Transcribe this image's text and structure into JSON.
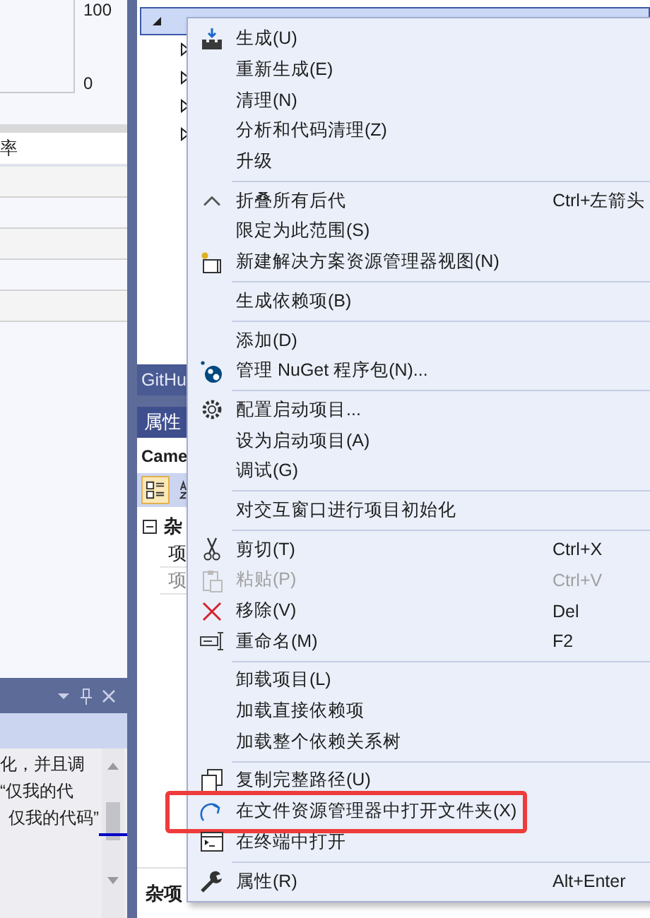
{
  "left_panel": {
    "chart": {
      "axis_labels": [
        "100",
        "0"
      ]
    },
    "grid": {
      "column_header": "率"
    }
  },
  "output_panel": {
    "lines": [
      "化，并且调",
      "“仅我的代",
      "仅我的代码”"
    ]
  },
  "solution_explorer": {
    "selected_row": {
      "expanded": true,
      "selected": true
    },
    "child_rows": [
      {
        "expanded": false
      },
      {
        "expanded": false
      },
      {
        "expanded": false
      },
      {
        "expanded": false
      }
    ]
  },
  "tool_tabs": [
    {
      "label": "GitHu"
    }
  ],
  "properties": {
    "title": "属性",
    "object": "Came",
    "view_buttons": [
      {
        "kind": "categorized",
        "selected": true
      },
      {
        "kind": "alphabetical",
        "selected": false
      }
    ],
    "category": {
      "label": "杂",
      "expanded": true
    },
    "property_rows": [
      {
        "label": "项",
        "disabled": false
      },
      {
        "label": "项",
        "disabled": true
      }
    ],
    "description_title": "杂项"
  },
  "context_menu": {
    "groups": [
      [
        {
          "label": "生成(U)",
          "disabled": false,
          "highlighted": false
        },
        {
          "label": "重新生成(E)",
          "disabled": false,
          "highlighted": false
        },
        {
          "label": "清理(N)",
          "disabled": false,
          "highlighted": false
        },
        {
          "label": "分析和代码清理(Z)",
          "disabled": false,
          "highlighted": false
        },
        {
          "label": "升级",
          "disabled": false,
          "highlighted": false
        }
      ],
      [
        {
          "label": "折叠所有后代",
          "shortcut": "Ctrl+左箭头",
          "disabled": false,
          "highlighted": false
        },
        {
          "label": "限定为此范围(S)",
          "disabled": false,
          "highlighted": false
        },
        {
          "label": "新建解决方案资源管理器视图(N)",
          "disabled": false,
          "highlighted": false
        }
      ],
      [
        {
          "label": "生成依赖项(B)",
          "disabled": false,
          "highlighted": false
        }
      ],
      [
        {
          "label": "添加(D)",
          "disabled": false,
          "highlighted": false
        },
        {
          "label": "管理 NuGet 程序包(N)...",
          "disabled": false,
          "highlighted": false
        }
      ],
      [
        {
          "label": "配置启动项目...",
          "disabled": false,
          "highlighted": false
        },
        {
          "label": "设为启动项目(A)",
          "disabled": false,
          "highlighted": false
        },
        {
          "label": "调试(G)",
          "disabled": false,
          "highlighted": false
        }
      ],
      [
        {
          "label": "对交互窗口进行项目初始化",
          "disabled": false,
          "highlighted": false
        }
      ],
      [
        {
          "label": "剪切(T)",
          "shortcut": "Ctrl+X",
          "disabled": false,
          "highlighted": false
        },
        {
          "label": "粘贴(P)",
          "shortcut": "Ctrl+V",
          "disabled": true,
          "highlighted": false
        },
        {
          "label": "移除(V)",
          "shortcut": "Del",
          "disabled": false,
          "highlighted": false
        },
        {
          "label": "重命名(M)",
          "shortcut": "F2",
          "disabled": false,
          "highlighted": false
        }
      ],
      [
        {
          "label": "卸载项目(L)",
          "disabled": false,
          "highlighted": false
        },
        {
          "label": "加载直接依赖项",
          "disabled": false,
          "highlighted": false
        },
        {
          "label": "加载整个依赖关系树",
          "disabled": false,
          "highlighted": false
        }
      ],
      [
        {
          "label": "复制完整路径(U)",
          "disabled": false,
          "highlighted": false
        },
        {
          "label": "在文件资源管理器中打开文件夹(X)",
          "disabled": false,
          "highlighted": true
        },
        {
          "label": "在终端中打开",
          "disabled": false,
          "highlighted": false
        }
      ],
      [
        {
          "label": "属性(R)",
          "shortcut": "Alt+Enter",
          "disabled": false,
          "highlighted": false
        }
      ]
    ]
  }
}
